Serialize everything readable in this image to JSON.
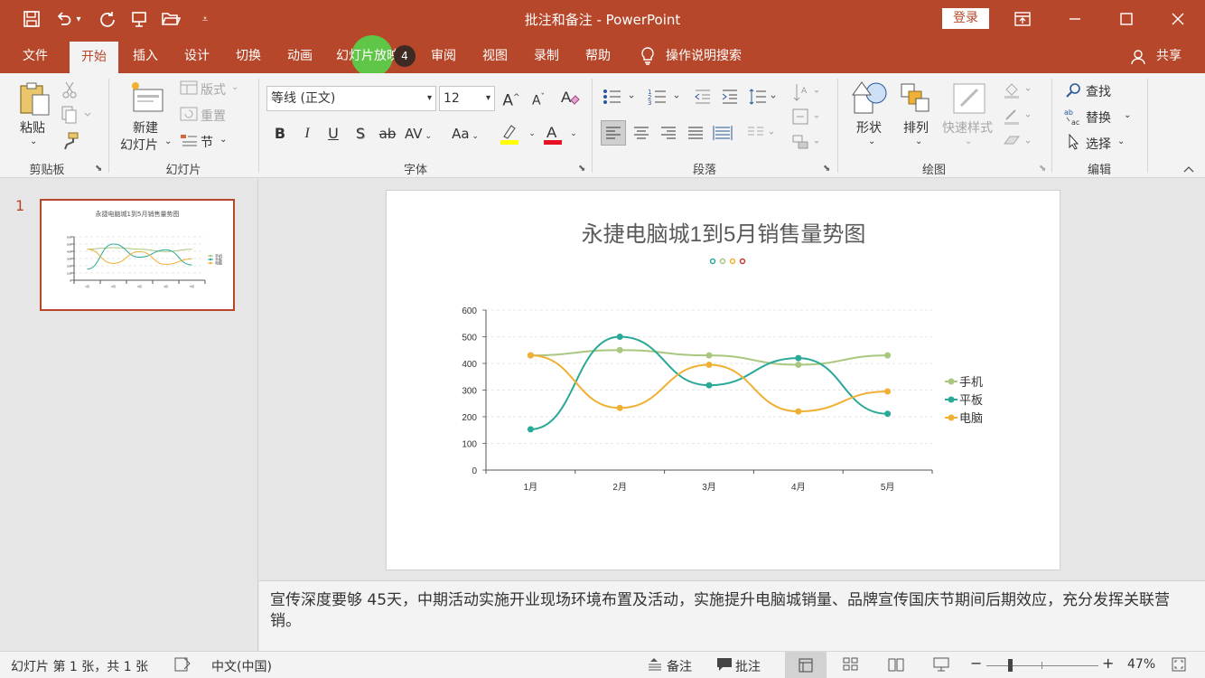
{
  "window": {
    "title": "批注和备注 - PowerPoint",
    "login_label": "登录",
    "share_label": "共享"
  },
  "tabs": {
    "file": "文件",
    "home": "开始",
    "insert": "插入",
    "design": "设计",
    "transitions": "切换",
    "animations": "动画",
    "slideshow": "幻灯片放映",
    "slideshow_badge": "4",
    "review": "审阅",
    "view": "视图",
    "record": "录制",
    "help": "帮助",
    "search": "操作说明搜索"
  },
  "ribbon": {
    "clipboard": {
      "label": "剪贴板",
      "paste": "粘贴"
    },
    "slides": {
      "label": "幻灯片",
      "new_slide_1": "新建",
      "new_slide_2": "幻灯片",
      "layout": "版式",
      "reset": "重置",
      "section": "节"
    },
    "font": {
      "label": "字体",
      "font_name": "等线 (正文)",
      "font_size": "12",
      "bold": "B",
      "italic": "I",
      "underline": "U",
      "shadow": "S",
      "strike": "ab",
      "spacing": "AV",
      "case": "Aa",
      "grow": "A",
      "shrink": "A",
      "font_color": "A"
    },
    "paragraph": {
      "label": "段落"
    },
    "drawing": {
      "label": "绘图",
      "shapes": "形状",
      "arrange": "排列",
      "quick_styles": "快速样式"
    },
    "editing": {
      "label": "编辑",
      "find": "查找",
      "replace": "替换",
      "select": "选择"
    }
  },
  "thumbnail": {
    "number": "1",
    "title": "永捷电脑城1到5月销售量势图"
  },
  "chart_data": {
    "type": "line",
    "title": "永捷电脑城1到5月销售量势图",
    "categories": [
      "1月",
      "2月",
      "3月",
      "4月",
      "5月"
    ],
    "ylim": [
      0,
      600
    ],
    "yticks": [
      "0",
      "100",
      "200",
      "300",
      "400",
      "500",
      "600"
    ],
    "legend_position": "right",
    "smooth": true,
    "series": [
      {
        "name": "手机",
        "color": "#a9c77e",
        "values": [
          430,
          450,
          430,
          395,
          430
        ]
      },
      {
        "name": "平板",
        "color": "#2aa898",
        "values": [
          153,
          500,
          318,
          420,
          211
        ]
      },
      {
        "name": "电脑",
        "color": "#f0b034",
        "values": [
          430,
          233,
          395,
          220,
          295
        ]
      }
    ],
    "title_dot_colors": [
      "#2aa898",
      "#a9c77e",
      "#f0b034",
      "#c0392b"
    ]
  },
  "notes": {
    "text": "宣传深度要够 45天，中期活动实施开业现场环境布置及活动，实施提升电脑城销量、品牌宣传国庆节期间后期效应，充分发挥关联营销。"
  },
  "status": {
    "slide_info": "幻灯片 第 1 张，共 1 张",
    "language": "中文(中国)",
    "notes_label": "备注",
    "comments_label": "批注",
    "zoom": "47%"
  }
}
